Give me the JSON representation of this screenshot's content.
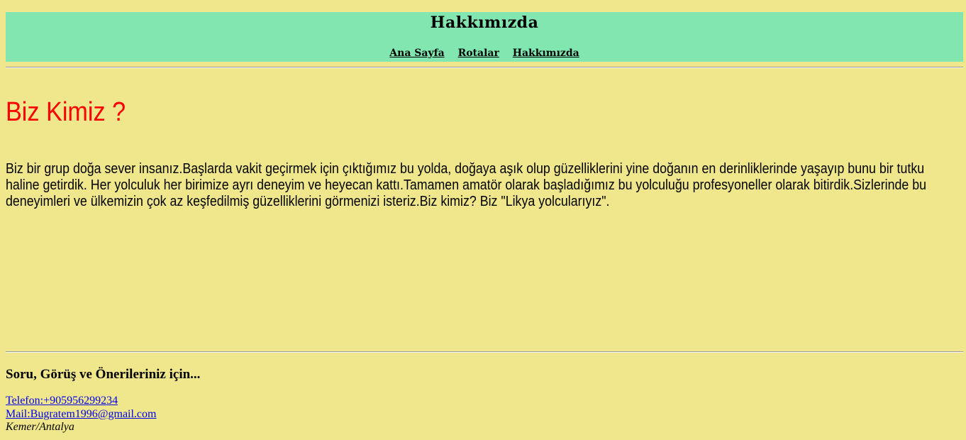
{
  "header": {
    "title": "Hakkımızda",
    "nav": [
      {
        "label": "Ana Sayfa"
      },
      {
        "label": "Rotalar"
      },
      {
        "label": "Hakkımızda"
      }
    ]
  },
  "main": {
    "heading": "Biz Kimiz ?",
    "paragraph": "Biz bir grup doğa sever insanız.Başlarda vakit geçirmek için çıktığımız bu yolda, doğaya aşık olup güzelliklerini yine doğanın en derinliklerinde yaşayıp bunu bir tutku haline getirdik. Her yolculuk her birimize ayrı deneyim ve heyecan kattı.Tamamen amatör olarak başladığımız bu yolculuğu profesyoneller olarak bitirdik.Sizlerinde bu deneyimleri ve ülkemizin çok az keşfedilmiş güzelliklerini görmenizi isteriz.Biz kimiz? Biz \"Likya yolcularıyız\"."
  },
  "footer": {
    "heading": "Soru, Görüş ve Önerileriniz için...",
    "phone": "Telefon:+905956299234",
    "mail": "Mail:Bugratem1996@gmail.com",
    "location": "Kemer/Antalya"
  },
  "colors": {
    "page_background": "#f0e68c",
    "header_background": "#82e6b0",
    "heading_color": "#ff0000",
    "link_color": "#0000ee"
  }
}
